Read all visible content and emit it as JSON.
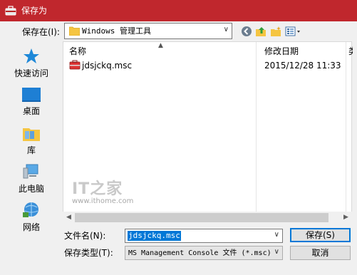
{
  "window": {
    "title": "保存为",
    "accent": "#c0272d"
  },
  "location": {
    "label": "保存在(I):",
    "path": "Windows 管理工具",
    "icons": [
      "back-icon",
      "up-folder-icon",
      "new-folder-icon",
      "view-menu-icon"
    ]
  },
  "nav": {
    "items": [
      {
        "label": "快速访问",
        "icon": "star-icon"
      },
      {
        "label": "桌面",
        "icon": "desktop-icon"
      },
      {
        "label": "库",
        "icon": "library-icon"
      },
      {
        "label": "此电脑",
        "icon": "computer-icon"
      },
      {
        "label": "网络",
        "icon": "network-icon"
      }
    ]
  },
  "filelist": {
    "columns": [
      "名称",
      "修改日期",
      "类"
    ],
    "files": [
      {
        "name": "jdsjckq.msc",
        "modified": "2015/12/28 11:33",
        "icon": "msc-file-icon"
      }
    ],
    "watermark": {
      "logo": "IT之家",
      "url": "www.ithome.com"
    }
  },
  "form": {
    "filename_label": "文件名(N):",
    "filename_value": "jdsjckq.msc",
    "filetype_label": "保存类型(T):",
    "filetype_value": "MS Management Console 文件 (*.msc)",
    "save_label": "保存(S)",
    "cancel_label": "取消"
  }
}
